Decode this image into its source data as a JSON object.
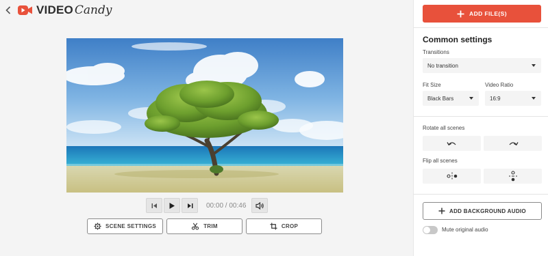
{
  "app": {
    "brand_word": "VIDEO",
    "brand_script": "Candy",
    "brand_color": "#e8513b"
  },
  "player": {
    "time": "00:00 / 00:46"
  },
  "tools": [
    {
      "label": "SCENE SETTINGS",
      "icon": "gear-icon"
    },
    {
      "label": "TRIM",
      "icon": "scissors-icon"
    },
    {
      "label": "CROP",
      "icon": "crop-icon"
    }
  ],
  "panel": {
    "add_files_label": "ADD FILE(S)",
    "common_settings_title": "Common settings",
    "transitions_label": "Transitions",
    "transitions_value": "No transition",
    "fit_size_label": "Fit Size",
    "fit_size_value": "Black Bars",
    "video_ratio_label": "Video Ratio",
    "video_ratio_value": "16:9",
    "rotate_label": "Rotate all scenes",
    "flip_label": "Flip all scenes",
    "background_audio_label": "ADD BACKGROUND AUDIO",
    "mute_label": "Mute original audio",
    "mute_enabled": false
  }
}
